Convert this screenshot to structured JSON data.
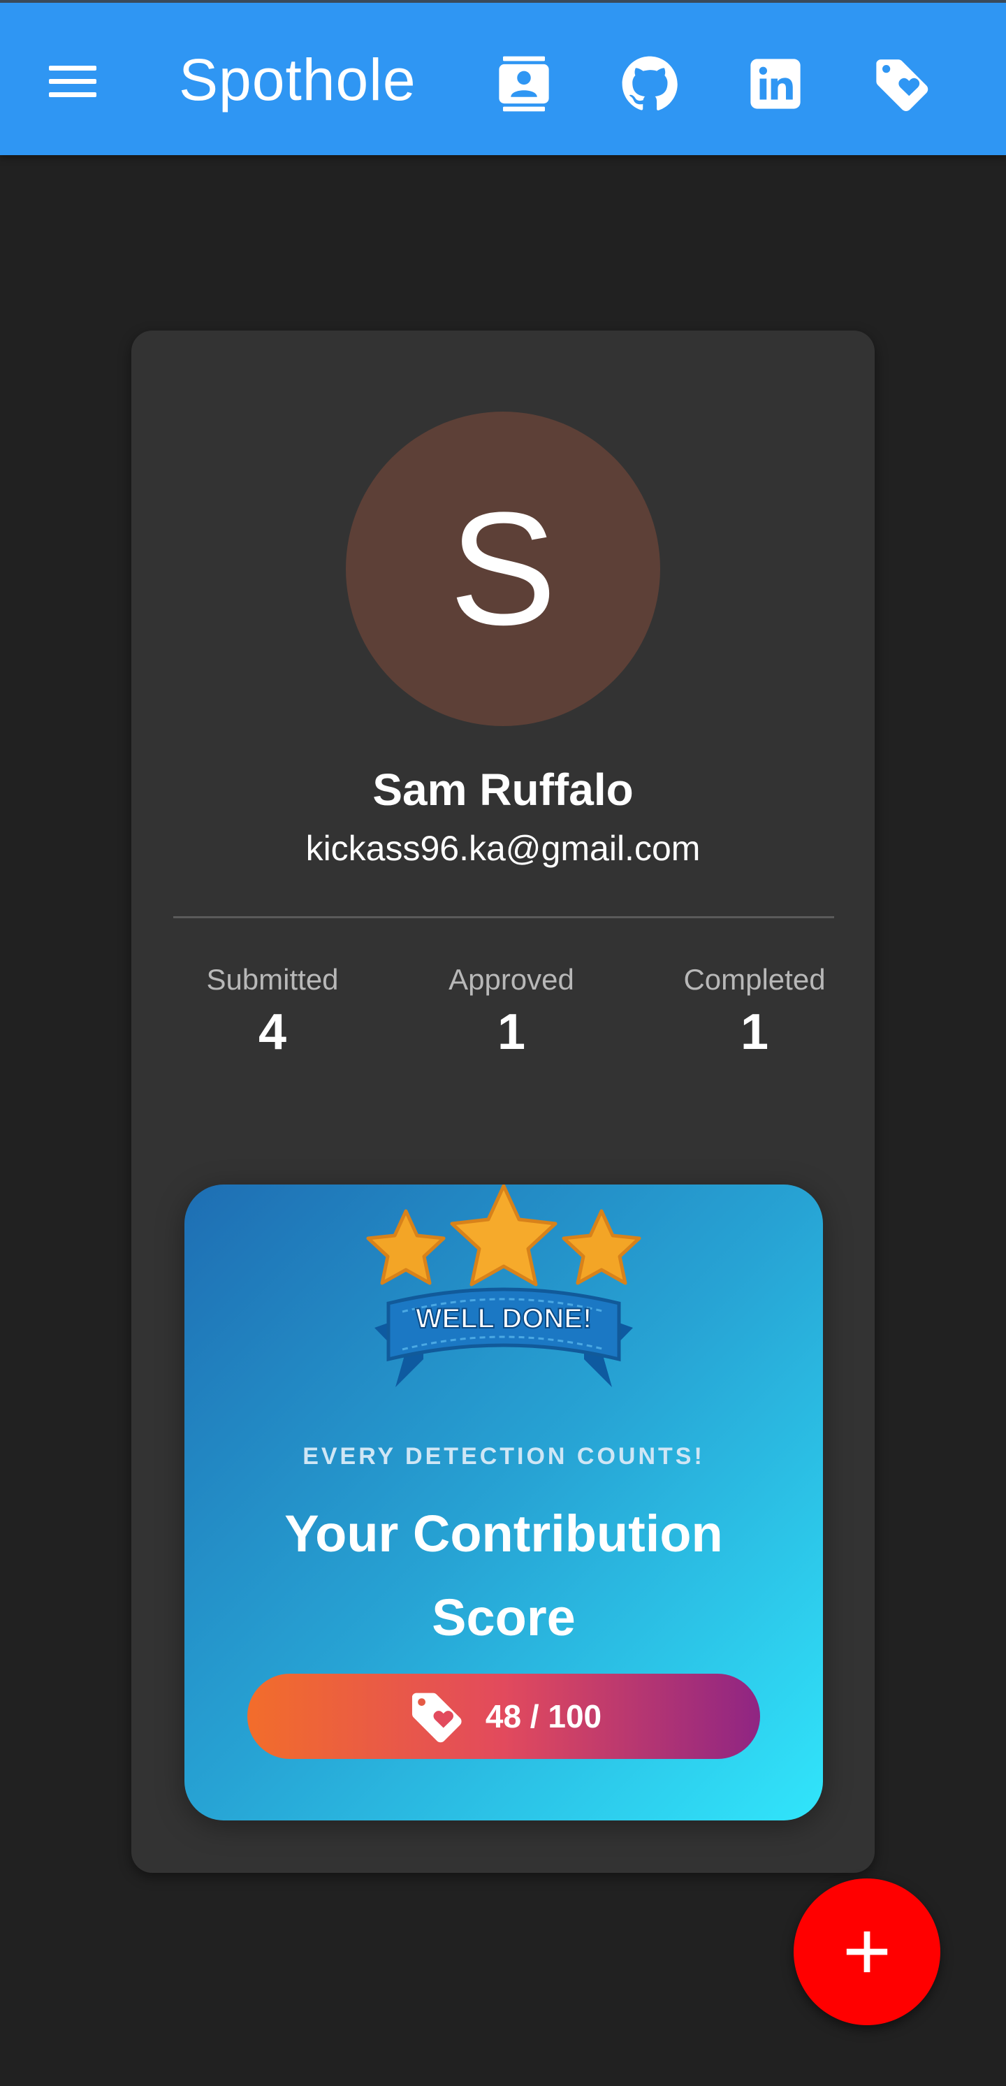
{
  "app_bar": {
    "title": "Spothole",
    "menu_icon": "menu-icon",
    "actions": [
      {
        "icon": "contact-card-icon"
      },
      {
        "icon": "github-icon"
      },
      {
        "icon": "linkedin-icon"
      },
      {
        "icon": "tag-heart-icon"
      }
    ],
    "background_color": "#2f96f3"
  },
  "profile": {
    "avatar_letter": "S",
    "avatar_color": "#5d4037",
    "name": "Sam Ruffalo",
    "email": "kickass96.ka@gmail.com"
  },
  "stats": [
    {
      "label": "Submitted",
      "value": "4"
    },
    {
      "label": "Approved",
      "value": "1"
    },
    {
      "label": "Completed",
      "value": "1"
    }
  ],
  "contribution": {
    "badge_text": "WELL DONE!",
    "kicker": "EVERY DETECTION COUNTS!",
    "title": "Your Contribution Score",
    "score": "48 / 100",
    "score_icon": "tag-heart-icon"
  },
  "fab": {
    "icon": "plus-icon",
    "color": "#ff0000"
  }
}
